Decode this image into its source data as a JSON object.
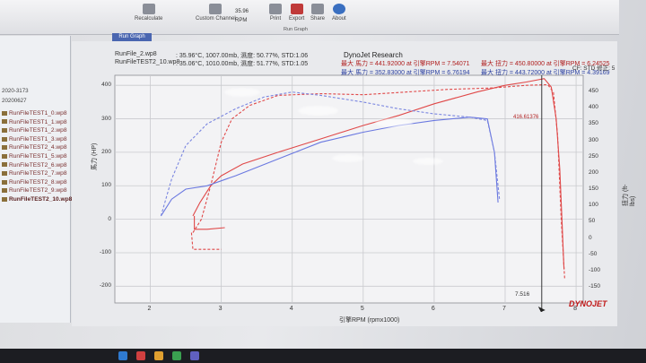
{
  "ribbon": {
    "buttons": [
      {
        "label": "Recalculate",
        "x": 0
      },
      {
        "label": "Custom Channel",
        "x": 0
      },
      {
        "label": "Print",
        "x": 0
      },
      {
        "label": "Export",
        "x": 0
      },
      {
        "label": "Share",
        "x": 0
      },
      {
        "label": "About",
        "x": 0
      }
    ],
    "group_label": "Run Graph",
    "small_text": [
      "35.96",
      "RPM"
    ]
  },
  "sidebar": {
    "items": [
      {
        "label": "RunFileTEST1_0.wp8",
        "type": "file"
      },
      {
        "label": "RunFileTEST1_1.wp8",
        "type": "file"
      },
      {
        "label": "RunFileTEST1_2.wp8",
        "type": "file"
      },
      {
        "label": "RunFileTEST1_3.wp8",
        "type": "file"
      },
      {
        "label": "RunFileTEST2_4.wp8",
        "type": "file"
      },
      {
        "label": "RunFileTEST1_5.wp8",
        "type": "file"
      },
      {
        "label": "RunFileTEST2_6.wp8",
        "type": "file"
      },
      {
        "label": "RunFileTEST2_7.wp8",
        "type": "file"
      },
      {
        "label": "RunFileTEST2_8.wp8",
        "type": "file"
      },
      {
        "label": "RunFileTEST2_9.wp8",
        "type": "file"
      },
      {
        "label": "RunFileTEST2_10.wp8",
        "type": "file-bold"
      }
    ],
    "folders": [
      "20200627",
      "2020-3173"
    ]
  },
  "graph_tab": "Run Graph",
  "header": {
    "title": "DynoJet Research",
    "run1_file": "RunFile_2.wp8",
    "run1_info": ": 35.96°C, 1007.00mb, 濕度: 50.77%, STD:1.06",
    "run2_file": "RunFileTEST2_10.wp8",
    "run2_info": ": 35.06°C, 1010.00mb, 濕度: 51.77%, STD:1.05",
    "run1_hp": "最大 馬力 = 441.92000 at 引擎RPM = 7.54071",
    "run1_tq": "最大 扭力 = 450.80000 at 引擎RPM = 6.24525",
    "run2_hp": "最大 馬力 = 352.83000 at 引擎RPM = 6.76194",
    "run2_tq": "最大 扭力 = 443.72000 at 引擎RPM = 4.39169",
    "corr": "CF: STD 修正: 5"
  },
  "chart_data": {
    "type": "line",
    "xlabel": "引擎RPM (rpmx1000)",
    "ylabel_left": "馬力 (HP)",
    "ylabel_right": "扭力 (ft-lbs)",
    "x_ticks": [
      2,
      3,
      4,
      5,
      6,
      7,
      8
    ],
    "y_left_ticks": [
      -200,
      -100,
      0,
      100,
      200,
      300,
      400
    ],
    "y_right_ticks": [
      -150,
      -100,
      -50,
      0,
      50,
      100,
      150,
      200,
      250,
      300,
      350,
      400,
      450
    ],
    "xlim": [
      1.5,
      8.1
    ],
    "ylim": [
      -250,
      430
    ],
    "cursor_x": 7.516,
    "cursor_label": "7.516",
    "peak_annotation": "416.61376",
    "series": [
      {
        "color": "#e04848",
        "style": "solid",
        "points": [
          [
            2.6,
            10
          ],
          [
            2.7,
            50
          ],
          [
            2.85,
            100
          ],
          [
            3.0,
            130
          ],
          [
            3.3,
            165
          ],
          [
            3.8,
            200
          ],
          [
            4.4,
            240
          ],
          [
            5.0,
            280
          ],
          [
            5.5,
            310
          ],
          [
            6.0,
            345
          ],
          [
            6.6,
            380
          ],
          [
            7.0,
            400
          ],
          [
            7.3,
            410
          ],
          [
            7.55,
            420
          ],
          [
            7.65,
            395
          ],
          [
            7.72,
            300
          ],
          [
            7.77,
            150
          ],
          [
            7.8,
            0
          ],
          [
            7.83,
            -150
          ]
        ]
      },
      {
        "color": "#e04848",
        "style": "dashed",
        "points": [
          [
            2.6,
            -40
          ],
          [
            2.72,
            0
          ],
          [
            2.85,
            100
          ],
          [
            3.0,
            230
          ],
          [
            3.15,
            300
          ],
          [
            3.4,
            340
          ],
          [
            3.8,
            370
          ],
          [
            4.4,
            375
          ],
          [
            5.0,
            372
          ],
          [
            5.6,
            380
          ],
          [
            6.2,
            388
          ],
          [
            6.8,
            392
          ],
          [
            7.3,
            400
          ],
          [
            7.6,
            402
          ],
          [
            7.68,
            380
          ],
          [
            7.74,
            250
          ],
          [
            7.79,
            0
          ],
          [
            7.84,
            -180
          ]
        ]
      },
      {
        "color": "#6a78e0",
        "style": "solid",
        "points": [
          [
            2.15,
            10
          ],
          [
            2.3,
            60
          ],
          [
            2.5,
            90
          ],
          [
            2.8,
            100
          ],
          [
            3.2,
            130
          ],
          [
            3.8,
            180
          ],
          [
            4.4,
            230
          ],
          [
            5.0,
            260
          ],
          [
            5.5,
            280
          ],
          [
            6.0,
            295
          ],
          [
            6.5,
            305
          ],
          [
            6.75,
            300
          ],
          [
            6.85,
            200
          ],
          [
            6.9,
            50
          ]
        ]
      },
      {
        "color": "#7a86e0",
        "style": "dashed",
        "points": [
          [
            2.15,
            10
          ],
          [
            2.3,
            120
          ],
          [
            2.5,
            220
          ],
          [
            2.8,
            285
          ],
          [
            3.2,
            330
          ],
          [
            3.6,
            365
          ],
          [
            4.0,
            380
          ],
          [
            4.4,
            370
          ],
          [
            5.0,
            350
          ],
          [
            5.5,
            330
          ],
          [
            6.0,
            315
          ],
          [
            6.5,
            305
          ],
          [
            6.75,
            295
          ],
          [
            6.85,
            200
          ],
          [
            6.92,
            60
          ]
        ]
      },
      {
        "color": "#e04848",
        "style": "solid",
        "points": [
          [
            2.62,
            10
          ],
          [
            2.62,
            -30
          ],
          [
            2.8,
            -30
          ],
          [
            3.05,
            -25
          ]
        ]
      },
      {
        "color": "#e04848",
        "style": "dashed",
        "points": [
          [
            2.58,
            -40
          ],
          [
            2.6,
            -90
          ],
          [
            3.0,
            -90
          ]
        ]
      }
    ]
  },
  "logo": "DYNOJET",
  "colors": {
    "run1": "#e04848",
    "run2": "#6a78e0",
    "grid": "#c9cace"
  }
}
